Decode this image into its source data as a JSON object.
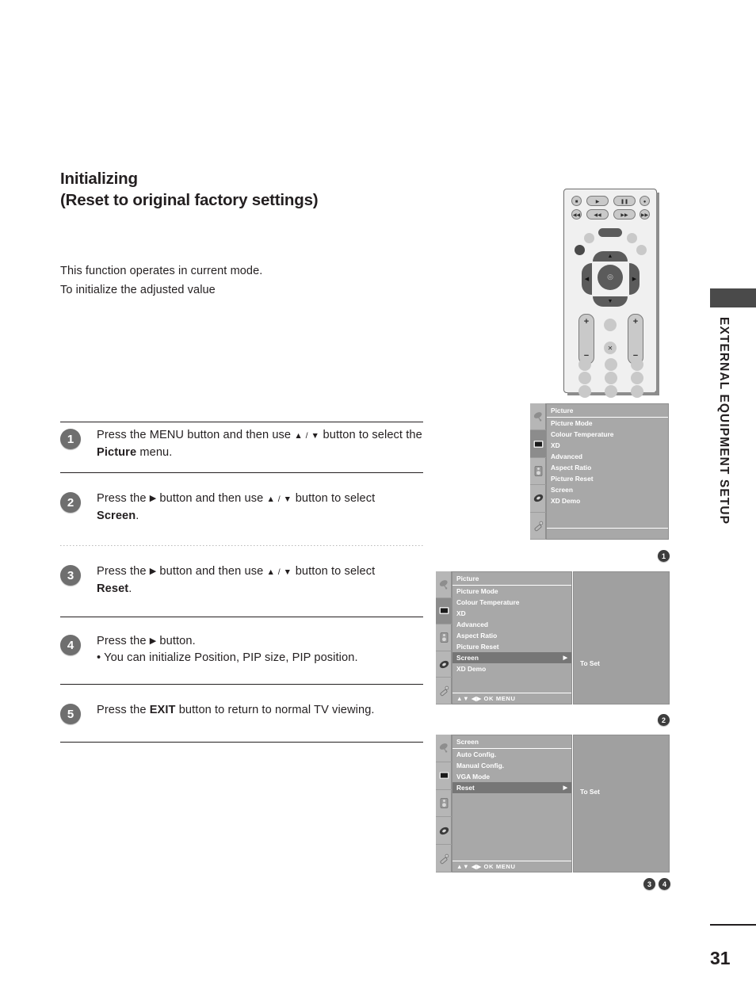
{
  "heading": {
    "line1": "Initializing",
    "line2": "(Reset to original factory settings)"
  },
  "intro": {
    "line1": "This function operates in current mode.",
    "line2": "To initialize the adjusted value"
  },
  "steps": [
    {
      "number": "1",
      "text_a": "Press the MENU button and then use ",
      "updown": "▲ / ▼",
      "text_b": " button to select the ",
      "bold": "Picture",
      "text_c": " menu."
    },
    {
      "number": "2",
      "text_a": "Press the ",
      "arrow": "▶",
      "text_b": " button and then use ",
      "updown": "▲ / ▼",
      "text_c": " button to select ",
      "bold": "Screen",
      "text_d": "."
    },
    {
      "number": "3",
      "text_a": "Press the ",
      "arrow": "▶",
      "text_b": " button and then use ",
      "updown": "▲ / ▼",
      "text_c": " button to select ",
      "bold": "Reset",
      "text_d": "."
    },
    {
      "number": "4",
      "text_a": "Press the ",
      "arrow": "▶",
      "text_b": " button.",
      "bullet": "• You can initialize Position, PIP size, PIP position."
    },
    {
      "number": "5",
      "text_a": "Press the ",
      "bold": "EXIT",
      "text_b": " button to return to normal TV viewing."
    }
  ],
  "side_tab": {
    "label": "EXTERNAL EQUIPMENT SETUP"
  },
  "osd_panel_1": {
    "marker": "1",
    "title": "Picture",
    "items": [
      "Picture Mode",
      "Colour Temperature",
      "XD",
      "Advanced",
      "Aspect Ratio",
      "Picture Reset",
      "Screen",
      "XD Demo"
    ],
    "icons": [
      "satellite-icon",
      "picture-icon",
      "audio-icon",
      "time-icon",
      "setup-icon"
    ],
    "active_icon_index": 1
  },
  "osd_panel_2": {
    "marker": "2",
    "title": "Picture",
    "items": [
      "Picture Mode",
      "Colour Temperature",
      "XD",
      "Advanced",
      "Aspect Ratio",
      "Picture Reset",
      "Screen",
      "XD Demo"
    ],
    "selected_item": "Screen",
    "selected_index": 6,
    "caret": "▶",
    "navbar": "▲▼  ◀▶  OK  MENU",
    "right_pane_label": "To Set",
    "icons": [
      "satellite-icon",
      "picture-icon",
      "audio-icon",
      "time-icon",
      "setup-icon"
    ],
    "active_icon_index": 1
  },
  "osd_panel_3": {
    "markers": [
      "3",
      "4"
    ],
    "title": "Screen",
    "items": [
      "Auto Config.",
      "Manual Config.",
      "VGA Mode",
      "Reset"
    ],
    "selected_item": "Reset",
    "selected_index": 3,
    "caret": "▶",
    "navbar": "▲▼  ◀▶  OK  MENU",
    "right_pane_label": "To Set",
    "icons": [
      "satellite-icon",
      "picture-icon",
      "audio-icon",
      "time-icon",
      "setup-icon"
    ],
    "active_icon_index": -1
  },
  "remote": {
    "name": "tv-remote-control",
    "buttons_row1": [
      "stop-button",
      "play-button",
      "pause-button",
      "record-button"
    ],
    "buttons_row2": [
      "prev-track-button",
      "rewind-button",
      "fast-forward-button",
      "next-track-button"
    ],
    "volume_plus": "+",
    "volume_minus": "−",
    "mute_glyph": "⊗"
  },
  "footer": {
    "page_number": "31"
  },
  "colors": {
    "text": "#231f20",
    "step_badge": "#6f6f6f",
    "osd_bg": "#a8a8a8",
    "osd_selected": "#767676",
    "osd_icon_col": "#b6b6b6",
    "side_tab": "#4a4a4a"
  }
}
